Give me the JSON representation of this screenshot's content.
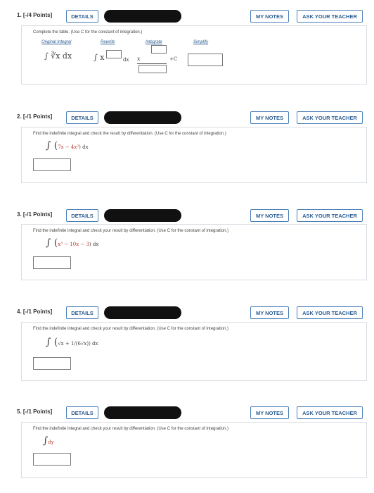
{
  "buttons": {
    "details": "DETAILS",
    "my_notes": "MY NOTES",
    "ask": "ASK YOUR TEACHER"
  },
  "questions": [
    {
      "label": "1. [-/4 Points]",
      "instruction": "Complete the table. (Use C for the constant of integration.)"
    },
    {
      "label": "2. [-/1 Points]",
      "instruction": "Find the indefinite integral and check the result by differentiation. (Use C for the constant of integration.)"
    },
    {
      "label": "3. [-/1 Points]",
      "instruction": "Find the indefinite integral and check your result by differentiation. (Use C for the constant of integration.)"
    },
    {
      "label": "4. [-/1 Points]",
      "instruction": "Find the indefinite integral and check your result by differentiation. (Use C for the constant of integration.)"
    },
    {
      "label": "5. [-/1 Points]",
      "instruction": "Find the indefinite integral and check your result by differentiation. (Use C for the constant of integration.)"
    }
  ],
  "q1_table": {
    "headers": [
      "Original Integral",
      "Rewrite",
      "Integrate",
      "Simplify"
    ],
    "original": "∫ ∛x dx",
    "rewrite_prefix": "∫ x",
    "rewrite_suffix": "dx",
    "integrate_x": "x",
    "plus_c": "+C"
  },
  "q2_expr": {
    "open": "∫ (",
    "inner": "7x − 4x²",
    "close": ") dx"
  },
  "q3_expr": {
    "open": "∫ (",
    "inner": "x³ − 10x − 3",
    "close": ") dx"
  },
  "q4_expr": {
    "open": "∫ (",
    "inner": "√x + 1/(6√x)",
    "close": ") dx"
  },
  "q5_expr": {
    "open": "∫",
    "inner": "dy"
  }
}
